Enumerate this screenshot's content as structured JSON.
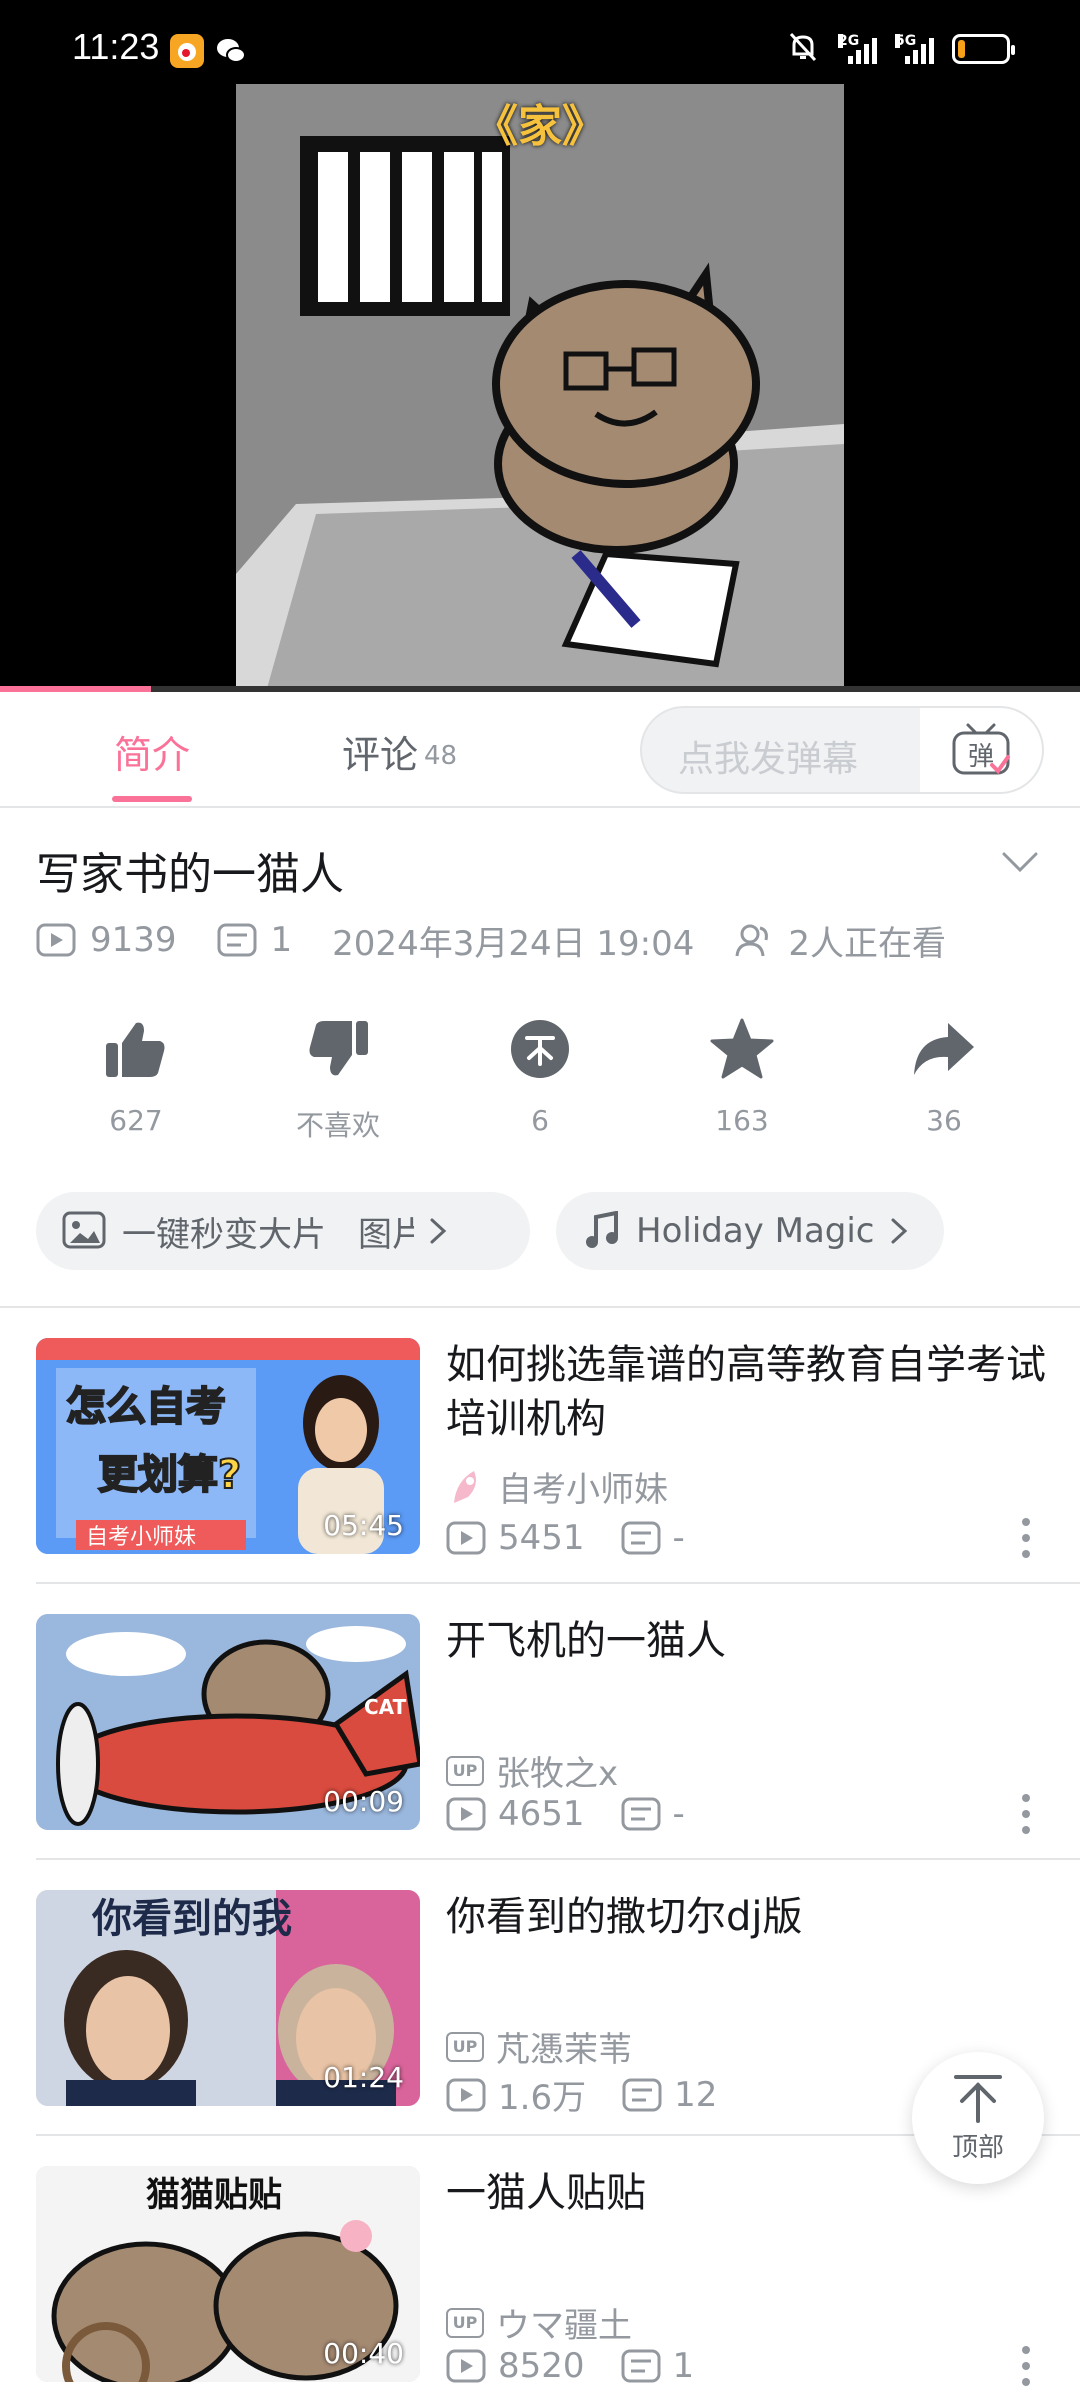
{
  "status_bar": {
    "time": "11:23",
    "signal_1_label": "2G",
    "signal_2_label": "5G",
    "battery_level": 0.15,
    "icons": [
      "weibo-icon",
      "wechat-icon",
      "mute-icon",
      "signal-icon",
      "battery-icon"
    ]
  },
  "player": {
    "overlay_title": "《家》",
    "progress": 0.14,
    "accent": "#fb7299"
  },
  "tabs": {
    "intro_label": "简介",
    "comments_label": "评论",
    "comments_count": "48",
    "danmaku_placeholder": "点我发弹幕",
    "danmaku_toggle_label": "弹"
  },
  "video": {
    "title": "写家书的一猫人",
    "views": "9139",
    "danmaku_count": "1",
    "date": "2024年3月24日 19:04",
    "watching": "2人正在看"
  },
  "actions": [
    {
      "icon": "like-icon",
      "label": "627"
    },
    {
      "icon": "dislike-icon",
      "label": "不喜欢"
    },
    {
      "icon": "coin-icon",
      "label": "6"
    },
    {
      "icon": "favorite-icon",
      "label": "163"
    },
    {
      "icon": "share-icon",
      "label": "36"
    }
  ],
  "pills": {
    "effect_label": "一键秒变大片",
    "effect_suffix": "图片",
    "music_label": "Holiday Magic"
  },
  "recommendations": [
    {
      "title": "如何挑选靠谱的高等教育自学考试培训机构",
      "author": "自考小师妹",
      "views": "5451",
      "danmaku": "-",
      "duration": "05:45",
      "thumb_text_1": "怎么自考",
      "thumb_text_2": "更划算?",
      "thumb_text_3": "自考小师妹"
    },
    {
      "title": "开飞机的一猫人",
      "author": "张牧之x",
      "views": "4651",
      "danmaku": "-",
      "duration": "00:09",
      "thumb_text_1": "CAT"
    },
    {
      "title": "你看到的撒切尔dj版",
      "author": "芃慿茉苇",
      "views": "1.6万",
      "danmaku": "12",
      "duration": "01:24",
      "thumb_text_1": "你看到的我"
    },
    {
      "title": "一猫人贴贴",
      "author": "ウマ疆土",
      "views": "8520",
      "danmaku": "1",
      "duration": "00:40",
      "thumb_text_1": "猫猫贴贴"
    }
  ],
  "up_badge": "UP",
  "back_to_top_label": "顶部"
}
